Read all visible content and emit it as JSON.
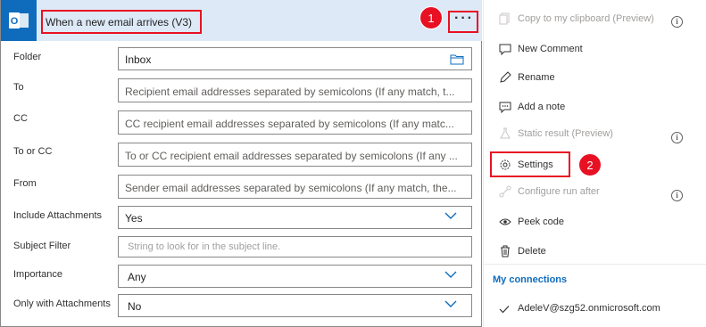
{
  "trigger": {
    "title": "When a new email arrives (V3)",
    "more_label": "···",
    "step_badge": "1"
  },
  "fields": [
    {
      "label": "Folder",
      "value": "Inbox"
    },
    {
      "label": "To",
      "placeholder": "Recipient email addresses separated by semicolons (If any match, t..."
    },
    {
      "label": "CC",
      "placeholder": "CC recipient email addresses separated by semicolons (If any matc..."
    },
    {
      "label": "To or CC",
      "placeholder": "To or CC recipient email addresses separated by semicolons (If any ..."
    },
    {
      "label": "From",
      "placeholder": "Sender email addresses separated by semicolons (If any match, the..."
    },
    {
      "label": "Include Attachments",
      "value": "Yes"
    },
    {
      "label": "Subject Filter",
      "placeholder": "String to look for in the subject line."
    },
    {
      "label": "Importance",
      "value": "Any"
    },
    {
      "label": "Only with Attachments",
      "value": "No"
    }
  ],
  "menu": {
    "items": [
      {
        "label": "Copy to my clipboard (Preview)",
        "icon": "copy-icon",
        "disabled": true,
        "info": true
      },
      {
        "label": "New Comment",
        "icon": "comment-icon"
      },
      {
        "label": "Rename",
        "icon": "pencil-icon"
      },
      {
        "label": "Add a note",
        "icon": "note-icon"
      },
      {
        "label": "Static result (Preview)",
        "icon": "flask-icon",
        "disabled": true,
        "info": true
      },
      {
        "label": "Settings",
        "icon": "gear-icon"
      },
      {
        "label": "Configure run after",
        "icon": "run-after-icon",
        "disabled": true,
        "info": true
      },
      {
        "label": "Peek code",
        "icon": "eye-icon"
      },
      {
        "label": "Delete",
        "icon": "trash-icon"
      }
    ],
    "info_glyph": "i",
    "step_badge": "2",
    "connections_title": "My connections",
    "connection": "AdeleV@szg52.onmicrosoft.com"
  },
  "colors": {
    "header_bg": "#dde9f7",
    "accent": "#0f6cbd",
    "highlight": "#e81123"
  }
}
